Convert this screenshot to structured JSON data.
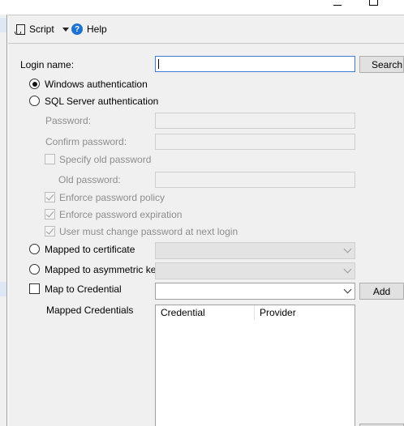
{
  "toolbar": {
    "script_label": "Script",
    "script_icon": "script-icon",
    "help_label": "Help",
    "help_icon": "help-icon",
    "help_glyph": "?"
  },
  "login": {
    "login_name_label": "Login name:",
    "login_name_value": "",
    "search_button": "Search..."
  },
  "authentication": {
    "windows_label": "Windows authentication",
    "sql_label": "SQL Server authentication",
    "selected": "windows",
    "password_label": "Password:",
    "confirm_password_label": "Confirm password:",
    "specify_old_password_label": "Specify old password",
    "old_password_label": "Old password:",
    "enforce_policy_label": "Enforce password policy",
    "enforce_expiration_label": "Enforce password expiration",
    "must_change_label": "User must change password at next login",
    "certificate_label": "Mapped to certificate",
    "asymmetric_key_label": "Mapped to asymmetric key"
  },
  "credential": {
    "map_label": "Map to Credential",
    "add_button": "Add",
    "mapped_label": "Mapped Credentials",
    "columns": [
      "Credential",
      "Provider"
    ]
  }
}
